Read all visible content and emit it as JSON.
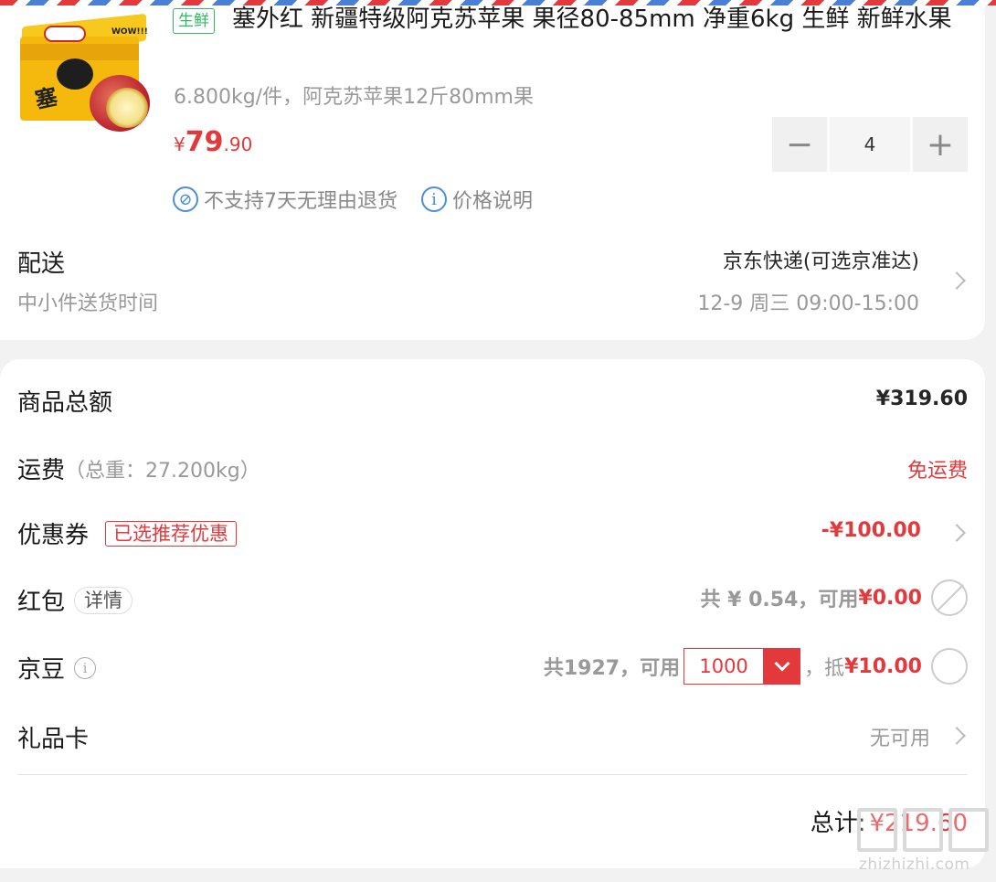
{
  "product": {
    "tag": "生鲜",
    "title": "塞外红 新疆特级阿克苏苹果 果径80-85mm 净重6kg 生鲜 新鲜水果",
    "spec": "6.800kg/件，阿克苏苹果12斤80mm果",
    "price_currency": "¥",
    "price_int": "79",
    "price_dec": ".90",
    "quantity": "4",
    "minus_symbol": "−",
    "plus_symbol": "+",
    "no_return_icon": "no-return-icon",
    "no_return_text": "不支持7天无理由退货",
    "price_info_icon": "info-icon",
    "price_info_text": "价格说明"
  },
  "delivery": {
    "label": "配送",
    "sub_label": "中小件送货时间",
    "method": "京东快递(可选京准达)",
    "time": "12-9 周三 09:00-15:00"
  },
  "summary": {
    "goods_total_label": "商品总额",
    "goods_total_value": "¥319.60",
    "shipping_label": "运费",
    "shipping_weight": "（总重：27.200kg）",
    "shipping_value": "免运费",
    "coupon_label": "优惠券",
    "coupon_tag": "已选推荐优惠",
    "coupon_value": "-¥100.00",
    "redpacket_label": "红包",
    "redpacket_detail": "详情",
    "redpacket_total": "共 ¥ 0.54，可用",
    "redpacket_value": "¥0.00",
    "jingdou_label": "京豆",
    "jingdou_total": "共1927，可用",
    "jingdou_input": "1000",
    "jingdou_deduct_prefix": "，抵",
    "jingdou_deduct": "¥10.00",
    "giftcard_label": "礼品卡",
    "giftcard_value": "无可用",
    "total_label": "总计:",
    "total_value": "¥219.60"
  },
  "watermark": {
    "text": "zhizhizhi.com",
    "glyphs": [
      "值",
      "值",
      "值"
    ]
  },
  "colors": {
    "accent_red": "#e4393c",
    "fresh_green": "#2dba62",
    "info_blue": "#4a8fd6"
  }
}
